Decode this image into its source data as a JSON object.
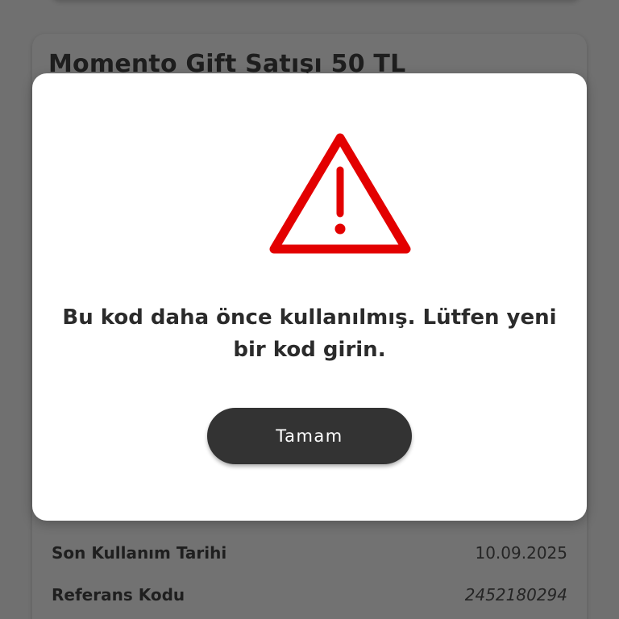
{
  "background": {
    "card_title": "Momento Gift Satışı 50 TL",
    "details": [
      {
        "label": "Son Kullanım Tarihi",
        "value": "10.09.2025"
      },
      {
        "label": "Referans Kodu",
        "value": "2452180294"
      }
    ]
  },
  "modal": {
    "icon": "warning-triangle-icon",
    "icon_color": "#e30000",
    "message": "Bu kod daha önce kullanılmış. Lütfen yeni bir kod girin.",
    "button_label": "Tamam"
  }
}
